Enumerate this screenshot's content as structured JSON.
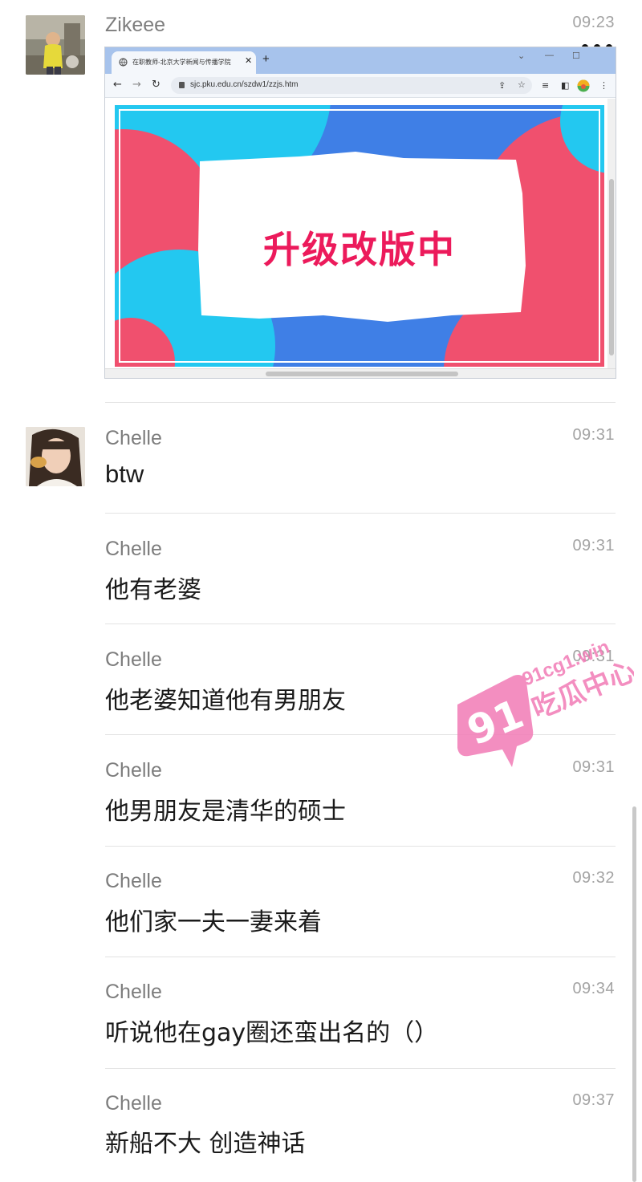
{
  "colors": {
    "sender": "#7d7d7d",
    "time": "#a3a3a3",
    "message": "#1a1a1a",
    "divider": "#e3e3e3",
    "banner_red": "#f0506e",
    "banner_cyan": "#23c8f0",
    "banner_blue": "#3f7fe6",
    "banner_text": "#ec1a5b",
    "watermark": "#f27bb6"
  },
  "header": {
    "back_icon": "chevron-left-icon",
    "more_icon": "ellipsis-icon"
  },
  "messages": [
    {
      "sender": "Zikeee",
      "time": "09:23",
      "type": "image",
      "image": {
        "tab_title": "在职教师-北京大学新闻与传播学院",
        "url": "sjc.pku.edu.cn/szdw1/zzjs.htm",
        "banner_text": "升级改版中"
      }
    },
    {
      "sender": "Chelle",
      "time": "09:31",
      "text": "btw"
    },
    {
      "sender": "Chelle",
      "time": "09:31",
      "text": "他有老婆"
    },
    {
      "sender": "Chelle",
      "time": "09:31",
      "text": "他老婆知道他有男朋友"
    },
    {
      "sender": "Chelle",
      "time": "09:31",
      "text": "他男朋友是清华的硕士"
    },
    {
      "sender": "Chelle",
      "time": "09:32",
      "text": "他们家一夫一妻来着"
    },
    {
      "sender": "Chelle",
      "time": "09:34",
      "text": "听说他在gay圈还蛮出名的（）"
    },
    {
      "sender": "Chelle",
      "time": "09:37",
      "text": "新船不大 创造神话"
    }
  ],
  "watermark": {
    "number": "91",
    "domain": "91cg1.win",
    "name": "吃瓜中心"
  }
}
